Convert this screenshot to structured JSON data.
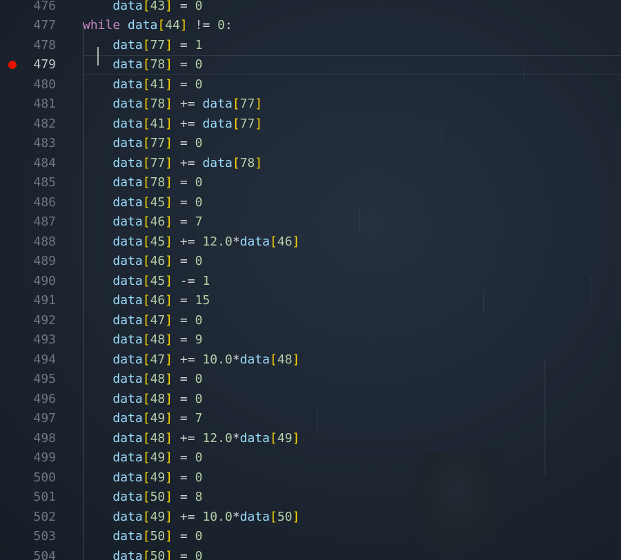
{
  "editor": {
    "colors": {
      "identifier": "#9cdcfe",
      "bracket": "#ffd700",
      "number": "#b5cea8",
      "operator": "#d4d4d4",
      "keyword": "#c586c0",
      "breakpoint": "#e51400"
    },
    "breakpoint_line": "479",
    "active_line": "479",
    "lines": [
      {
        "num": "476",
        "indent": "    ",
        "tokens": [
          {
            "t": "data",
            "c": "ident"
          },
          {
            "t": "[",
            "c": "brack"
          },
          {
            "t": "43",
            "c": "num"
          },
          {
            "t": "]",
            "c": "brack"
          },
          {
            "t": " = ",
            "c": "op"
          },
          {
            "t": "0",
            "c": "num"
          }
        ]
      },
      {
        "num": "477",
        "indent": "",
        "tokens": [
          {
            "t": "while",
            "c": "kw"
          },
          {
            "t": " ",
            "c": "op"
          },
          {
            "t": "data",
            "c": "ident"
          },
          {
            "t": "[",
            "c": "brack"
          },
          {
            "t": "44",
            "c": "num"
          },
          {
            "t": "]",
            "c": "brack"
          },
          {
            "t": " != ",
            "c": "op"
          },
          {
            "t": "0",
            "c": "num"
          },
          {
            "t": ":",
            "c": "op"
          }
        ]
      },
      {
        "num": "478",
        "indent": "    ",
        "tokens": [
          {
            "t": "data",
            "c": "ident"
          },
          {
            "t": "[",
            "c": "brack"
          },
          {
            "t": "77",
            "c": "num"
          },
          {
            "t": "]",
            "c": "brack"
          },
          {
            "t": " = ",
            "c": "op"
          },
          {
            "t": "1",
            "c": "num"
          }
        ]
      },
      {
        "num": "479",
        "indent": "    ",
        "tokens": [
          {
            "t": "data",
            "c": "ident"
          },
          {
            "t": "[",
            "c": "brack"
          },
          {
            "t": "78",
            "c": "num"
          },
          {
            "t": "]",
            "c": "brack"
          },
          {
            "t": " = ",
            "c": "op"
          },
          {
            "t": "0",
            "c": "num"
          }
        ]
      },
      {
        "num": "480",
        "indent": "    ",
        "tokens": [
          {
            "t": "data",
            "c": "ident"
          },
          {
            "t": "[",
            "c": "brack"
          },
          {
            "t": "41",
            "c": "num"
          },
          {
            "t": "]",
            "c": "brack"
          },
          {
            "t": " = ",
            "c": "op"
          },
          {
            "t": "0",
            "c": "num"
          }
        ]
      },
      {
        "num": "481",
        "indent": "    ",
        "tokens": [
          {
            "t": "data",
            "c": "ident"
          },
          {
            "t": "[",
            "c": "brack"
          },
          {
            "t": "78",
            "c": "num"
          },
          {
            "t": "]",
            "c": "brack"
          },
          {
            "t": " += ",
            "c": "op"
          },
          {
            "t": "data",
            "c": "ident"
          },
          {
            "t": "[",
            "c": "brack"
          },
          {
            "t": "77",
            "c": "num"
          },
          {
            "t": "]",
            "c": "brack"
          }
        ]
      },
      {
        "num": "482",
        "indent": "    ",
        "tokens": [
          {
            "t": "data",
            "c": "ident"
          },
          {
            "t": "[",
            "c": "brack"
          },
          {
            "t": "41",
            "c": "num"
          },
          {
            "t": "]",
            "c": "brack"
          },
          {
            "t": " += ",
            "c": "op"
          },
          {
            "t": "data",
            "c": "ident"
          },
          {
            "t": "[",
            "c": "brack"
          },
          {
            "t": "77",
            "c": "num"
          },
          {
            "t": "]",
            "c": "brack"
          }
        ]
      },
      {
        "num": "483",
        "indent": "    ",
        "tokens": [
          {
            "t": "data",
            "c": "ident"
          },
          {
            "t": "[",
            "c": "brack"
          },
          {
            "t": "77",
            "c": "num"
          },
          {
            "t": "]",
            "c": "brack"
          },
          {
            "t": " = ",
            "c": "op"
          },
          {
            "t": "0",
            "c": "num"
          }
        ]
      },
      {
        "num": "484",
        "indent": "    ",
        "tokens": [
          {
            "t": "data",
            "c": "ident"
          },
          {
            "t": "[",
            "c": "brack"
          },
          {
            "t": "77",
            "c": "num"
          },
          {
            "t": "]",
            "c": "brack"
          },
          {
            "t": " += ",
            "c": "op"
          },
          {
            "t": "data",
            "c": "ident"
          },
          {
            "t": "[",
            "c": "brack"
          },
          {
            "t": "78",
            "c": "num"
          },
          {
            "t": "]",
            "c": "brack"
          }
        ]
      },
      {
        "num": "485",
        "indent": "    ",
        "tokens": [
          {
            "t": "data",
            "c": "ident"
          },
          {
            "t": "[",
            "c": "brack"
          },
          {
            "t": "78",
            "c": "num"
          },
          {
            "t": "]",
            "c": "brack"
          },
          {
            "t": " = ",
            "c": "op"
          },
          {
            "t": "0",
            "c": "num"
          }
        ]
      },
      {
        "num": "486",
        "indent": "    ",
        "tokens": [
          {
            "t": "data",
            "c": "ident"
          },
          {
            "t": "[",
            "c": "brack"
          },
          {
            "t": "45",
            "c": "num"
          },
          {
            "t": "]",
            "c": "brack"
          },
          {
            "t": " = ",
            "c": "op"
          },
          {
            "t": "0",
            "c": "num"
          }
        ]
      },
      {
        "num": "487",
        "indent": "    ",
        "tokens": [
          {
            "t": "data",
            "c": "ident"
          },
          {
            "t": "[",
            "c": "brack"
          },
          {
            "t": "46",
            "c": "num"
          },
          {
            "t": "]",
            "c": "brack"
          },
          {
            "t": " = ",
            "c": "op"
          },
          {
            "t": "7",
            "c": "num"
          }
        ]
      },
      {
        "num": "488",
        "indent": "    ",
        "tokens": [
          {
            "t": "data",
            "c": "ident"
          },
          {
            "t": "[",
            "c": "brack"
          },
          {
            "t": "45",
            "c": "num"
          },
          {
            "t": "]",
            "c": "brack"
          },
          {
            "t": " += ",
            "c": "op"
          },
          {
            "t": "12.0",
            "c": "num"
          },
          {
            "t": "*",
            "c": "op"
          },
          {
            "t": "data",
            "c": "ident"
          },
          {
            "t": "[",
            "c": "brack"
          },
          {
            "t": "46",
            "c": "num"
          },
          {
            "t": "]",
            "c": "brack"
          }
        ]
      },
      {
        "num": "489",
        "indent": "    ",
        "tokens": [
          {
            "t": "data",
            "c": "ident"
          },
          {
            "t": "[",
            "c": "brack"
          },
          {
            "t": "46",
            "c": "num"
          },
          {
            "t": "]",
            "c": "brack"
          },
          {
            "t": " = ",
            "c": "op"
          },
          {
            "t": "0",
            "c": "num"
          }
        ]
      },
      {
        "num": "490",
        "indent": "    ",
        "tokens": [
          {
            "t": "data",
            "c": "ident"
          },
          {
            "t": "[",
            "c": "brack"
          },
          {
            "t": "45",
            "c": "num"
          },
          {
            "t": "]",
            "c": "brack"
          },
          {
            "t": " -= ",
            "c": "op"
          },
          {
            "t": "1",
            "c": "num"
          }
        ]
      },
      {
        "num": "491",
        "indent": "    ",
        "tokens": [
          {
            "t": "data",
            "c": "ident"
          },
          {
            "t": "[",
            "c": "brack"
          },
          {
            "t": "46",
            "c": "num"
          },
          {
            "t": "]",
            "c": "brack"
          },
          {
            "t": " = ",
            "c": "op"
          },
          {
            "t": "15",
            "c": "num"
          }
        ]
      },
      {
        "num": "492",
        "indent": "    ",
        "tokens": [
          {
            "t": "data",
            "c": "ident"
          },
          {
            "t": "[",
            "c": "brack"
          },
          {
            "t": "47",
            "c": "num"
          },
          {
            "t": "]",
            "c": "brack"
          },
          {
            "t": " = ",
            "c": "op"
          },
          {
            "t": "0",
            "c": "num"
          }
        ]
      },
      {
        "num": "493",
        "indent": "    ",
        "tokens": [
          {
            "t": "data",
            "c": "ident"
          },
          {
            "t": "[",
            "c": "brack"
          },
          {
            "t": "48",
            "c": "num"
          },
          {
            "t": "]",
            "c": "brack"
          },
          {
            "t": " = ",
            "c": "op"
          },
          {
            "t": "9",
            "c": "num"
          }
        ]
      },
      {
        "num": "494",
        "indent": "    ",
        "tokens": [
          {
            "t": "data",
            "c": "ident"
          },
          {
            "t": "[",
            "c": "brack"
          },
          {
            "t": "47",
            "c": "num"
          },
          {
            "t": "]",
            "c": "brack"
          },
          {
            "t": " += ",
            "c": "op"
          },
          {
            "t": "10.0",
            "c": "num"
          },
          {
            "t": "*",
            "c": "op"
          },
          {
            "t": "data",
            "c": "ident"
          },
          {
            "t": "[",
            "c": "brack"
          },
          {
            "t": "48",
            "c": "num"
          },
          {
            "t": "]",
            "c": "brack"
          }
        ]
      },
      {
        "num": "495",
        "indent": "    ",
        "tokens": [
          {
            "t": "data",
            "c": "ident"
          },
          {
            "t": "[",
            "c": "brack"
          },
          {
            "t": "48",
            "c": "num"
          },
          {
            "t": "]",
            "c": "brack"
          },
          {
            "t": " = ",
            "c": "op"
          },
          {
            "t": "0",
            "c": "num"
          }
        ]
      },
      {
        "num": "496",
        "indent": "    ",
        "tokens": [
          {
            "t": "data",
            "c": "ident"
          },
          {
            "t": "[",
            "c": "brack"
          },
          {
            "t": "48",
            "c": "num"
          },
          {
            "t": "]",
            "c": "brack"
          },
          {
            "t": " = ",
            "c": "op"
          },
          {
            "t": "0",
            "c": "num"
          }
        ]
      },
      {
        "num": "497",
        "indent": "    ",
        "tokens": [
          {
            "t": "data",
            "c": "ident"
          },
          {
            "t": "[",
            "c": "brack"
          },
          {
            "t": "49",
            "c": "num"
          },
          {
            "t": "]",
            "c": "brack"
          },
          {
            "t": " = ",
            "c": "op"
          },
          {
            "t": "7",
            "c": "num"
          }
        ]
      },
      {
        "num": "498",
        "indent": "    ",
        "tokens": [
          {
            "t": "data",
            "c": "ident"
          },
          {
            "t": "[",
            "c": "brack"
          },
          {
            "t": "48",
            "c": "num"
          },
          {
            "t": "]",
            "c": "brack"
          },
          {
            "t": " += ",
            "c": "op"
          },
          {
            "t": "12.0",
            "c": "num"
          },
          {
            "t": "*",
            "c": "op"
          },
          {
            "t": "data",
            "c": "ident"
          },
          {
            "t": "[",
            "c": "brack"
          },
          {
            "t": "49",
            "c": "num"
          },
          {
            "t": "]",
            "c": "brack"
          }
        ]
      },
      {
        "num": "499",
        "indent": "    ",
        "tokens": [
          {
            "t": "data",
            "c": "ident"
          },
          {
            "t": "[",
            "c": "brack"
          },
          {
            "t": "49",
            "c": "num"
          },
          {
            "t": "]",
            "c": "brack"
          },
          {
            "t": " = ",
            "c": "op"
          },
          {
            "t": "0",
            "c": "num"
          }
        ]
      },
      {
        "num": "500",
        "indent": "    ",
        "tokens": [
          {
            "t": "data",
            "c": "ident"
          },
          {
            "t": "[",
            "c": "brack"
          },
          {
            "t": "49",
            "c": "num"
          },
          {
            "t": "]",
            "c": "brack"
          },
          {
            "t": " = ",
            "c": "op"
          },
          {
            "t": "0",
            "c": "num"
          }
        ]
      },
      {
        "num": "501",
        "indent": "    ",
        "tokens": [
          {
            "t": "data",
            "c": "ident"
          },
          {
            "t": "[",
            "c": "brack"
          },
          {
            "t": "50",
            "c": "num"
          },
          {
            "t": "]",
            "c": "brack"
          },
          {
            "t": " = ",
            "c": "op"
          },
          {
            "t": "8",
            "c": "num"
          }
        ]
      },
      {
        "num": "502",
        "indent": "    ",
        "tokens": [
          {
            "t": "data",
            "c": "ident"
          },
          {
            "t": "[",
            "c": "brack"
          },
          {
            "t": "49",
            "c": "num"
          },
          {
            "t": "]",
            "c": "brack"
          },
          {
            "t": " += ",
            "c": "op"
          },
          {
            "t": "10.0",
            "c": "num"
          },
          {
            "t": "*",
            "c": "op"
          },
          {
            "t": "data",
            "c": "ident"
          },
          {
            "t": "[",
            "c": "brack"
          },
          {
            "t": "50",
            "c": "num"
          },
          {
            "t": "]",
            "c": "brack"
          }
        ]
      },
      {
        "num": "503",
        "indent": "    ",
        "tokens": [
          {
            "t": "data",
            "c": "ident"
          },
          {
            "t": "[",
            "c": "brack"
          },
          {
            "t": "50",
            "c": "num"
          },
          {
            "t": "]",
            "c": "brack"
          },
          {
            "t": " = ",
            "c": "op"
          },
          {
            "t": "0",
            "c": "num"
          }
        ]
      },
      {
        "num": "504",
        "indent": "    ",
        "tokens": [
          {
            "t": "data",
            "c": "ident"
          },
          {
            "t": "[",
            "c": "brack"
          },
          {
            "t": "50",
            "c": "num"
          },
          {
            "t": "]",
            "c": "brack"
          },
          {
            "t": " = ",
            "c": "op"
          },
          {
            "t": "0",
            "c": "num"
          }
        ]
      }
    ]
  }
}
